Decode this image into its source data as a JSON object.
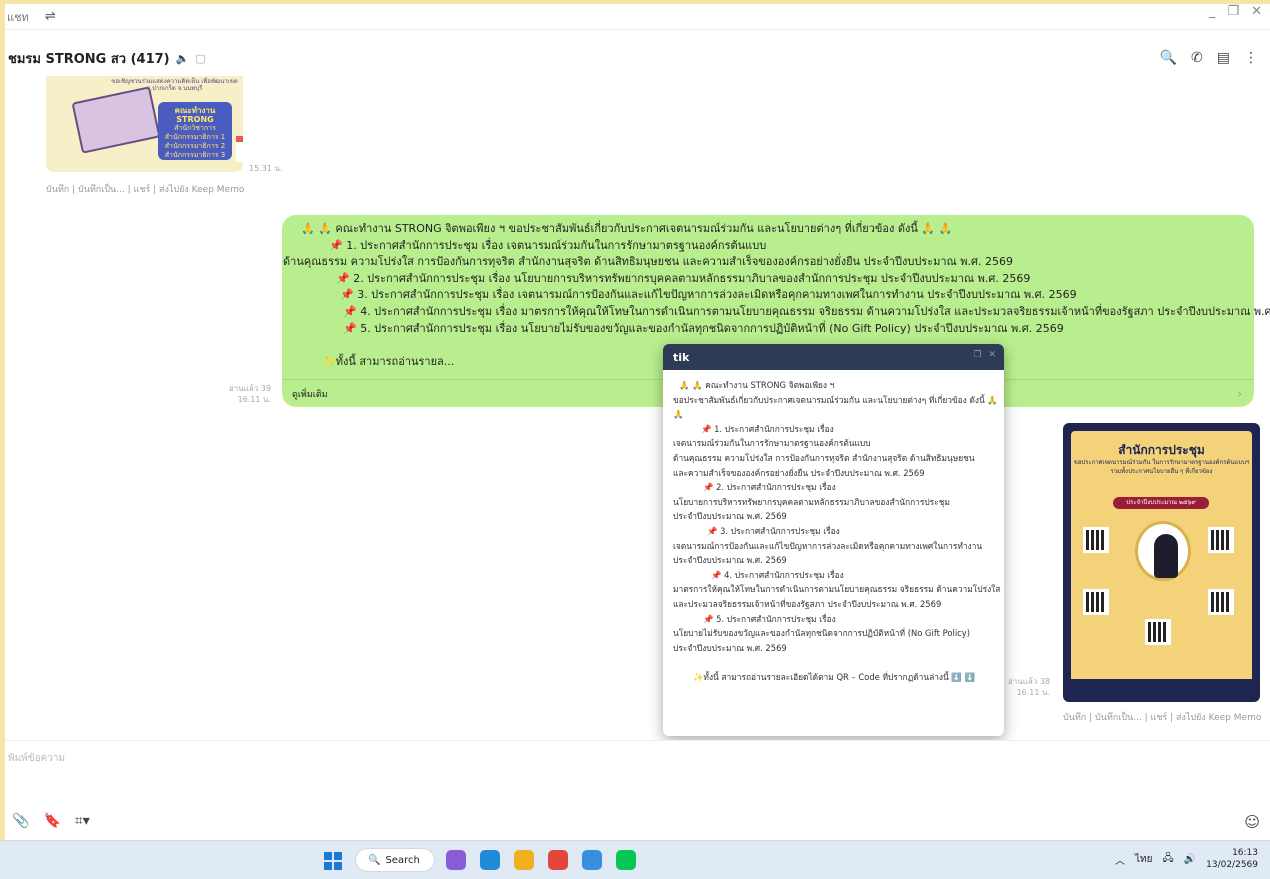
{
  "topbar": {
    "text": "แชท",
    "filter_icon": "filter-icon",
    "window_controls": [
      "_",
      "❐",
      "✕"
    ]
  },
  "chat": {
    "title": "ชมรม STRONG สว (417)",
    "header_icons_right": [
      "search-icon",
      "phone-icon",
      "notes-icon",
      "menu-icon"
    ]
  },
  "message1": {
    "image_top_text": "ขอเชิญชวนร่วมแสดงความคิดเห็น เพื่อพัฒนาเขต อ.ปากเกร็ด จ.นนทบุรี",
    "board_title": "คณะทำงาน STRONG",
    "board_lines": [
      "สำนักวิชาการ",
      "สำนักกรรมาธิการ 1",
      "สำนักกรรมาธิการ 2",
      "สำนักกรรมาธิการ 3"
    ],
    "time": "15.31 น.",
    "actions": "บันทึก | บันทึกเป็น... | แชร์ | ส่งไปยัง Keep Memo"
  },
  "message2": {
    "lines": [
      "🙏 🙏 คณะทำงาน STRONG จิตพอเพียง ฯ ขอประชาสัมพันธ์เกี่ยวกับประกาศเจตนารมณ์ร่วมกัน และนโยบายต่างๆ ที่เกี่ยวข้อง ดังนี้ 🙏 🙏",
      "📌 1. ประกาศสำนักการประชุม เรื่อง เจตนารมณ์ร่วมกันในการรักษามาตรฐานองค์กรต้นแบบ",
      "ด้านคุณธรรม ความโปร่งใส การป้องกันการทุจริต สำนักงานสุจริต ด้านสิทธิมนุษยชน และความสำเร็จขององค์กรอย่างยั่งยืน ประจำปีงบประมาณ พ.ศ. 2569",
      "📌 2. ประกาศสำนักการประชุม เรื่อง  นโยบายการบริหารทรัพยากรบุคคลตามหลักธรรมาภิบาลของสำนักการประชุม ประจำปีงบประมาณ พ.ศ. 2569",
      "📌 3. ประกาศสำนักการประชุม เรื่อง  เจตนารมณ์การป้องกันและแก้ไขปัญหาการล่วงละเมิดหรือคุกคามทางเพศในการทำงาน ประจำปีงบประมาณ พ.ศ. 2569",
      "📌 4. ประกาศสำนักการประชุม เรื่อง  มาตรการให้คุณให้โทษในการดำเนินการตามนโยบายคุณธรรม จริยธรรม ด้านความโปร่งใส และประมวลจริยธรรมเจ้าหน้าที่ของรัฐสภา ประจำปีงบประมาณ พ.ศ. 2569",
      "📌 5. ประกาศสำนักการประชุม เรื่อง  นโยบายไม่รับของขวัญและของกำนัลทุกชนิดจากการปฏิบัติหน้าที่ (No Gift Policy) ประจำปีงบประมาณ พ.ศ. 2569",
      "",
      "✨ทั้งนี้ สามารถอ่านรายล..."
    ],
    "see_more": "ดูเพิ่มเติม",
    "read": "อ่านแล้ว 39",
    "time": "16.11 น."
  },
  "popup": {
    "title": "tik",
    "lines": [
      "🙏 🙏 คณะทำงาน STRONG จิตพอเพียง ฯ",
      "ขอประชาสัมพันธ์เกี่ยวกับประกาศเจตนารมณ์ร่วมกัน และนโยบายต่างๆ ที่เกี่ยวข้อง ดังนี้ 🙏",
      "🙏",
      "📌 1. ประกาศสำนักการประชุม เรื่อง",
      "เจตนารมณ์ร่วมกันในการรักษามาตรฐานองค์กรต้นแบบ",
      "ด้านคุณธรรม ความโปร่งใส การป้องกันการทุจริต สำนักงานสุจริต ด้านสิทธิมนุษยชน",
      "และความสำเร็จขององค์กรอย่างยั่งยืน ประจำปีงบประมาณ พ.ศ. 2569",
      "📌 2. ประกาศสำนักการประชุม เรื่อง",
      "นโยบายการบริหารทรัพยากรบุคคลตามหลักธรรมาภิบาลของสำนักการประชุม",
      "ประจำปีงบประมาณ พ.ศ. 2569",
      "📌 3. ประกาศสำนักการประชุม เรื่อง",
      "เจตนารมณ์การป้องกันและแก้ไขปัญหาการล่วงละเมิดหรือคุกคามทางเพศในการทำงาน",
      "ประจำปีงบประมาณ พ.ศ. 2569",
      "📌 4. ประกาศสำนักการประชุม เรื่อง",
      "มาตรการให้คุณให้โทษในการดำเนินการตามนโยบายคุณธรรม จริยธรรม ด้านความโปร่งใส",
      "และประมวลจริยธรรมเจ้าหน้าที่ของรัฐสภา ประจำปีงบประมาณ พ.ศ. 2569",
      "📌 5. ประกาศสำนักการประชุม เรื่อง",
      "นโยบายไม่รับของขวัญและของกำนัลทุกชนิดจากการปฏิบัติหน้าที่ (No Gift Policy)",
      "ประจำปีงบประมาณ พ.ศ. 2569",
      "",
      "✨ทั้งนี้ สามารถอ่านรายละเอียดได้ตาม QR – Code ที่ปรากฏด้านล่างนี้ ⬇️ ⬇️"
    ]
  },
  "message3": {
    "poster_title": "สำนักการประชุม",
    "poster_sub": "ขอประกาศเจตนารมณ์ร่วมกัน ในการรักษามาตรฐานองค์กรต้นแบบฯ รวมทั้งประกาศนโยบายอื่น ๆ ที่เกี่ยวข้อง",
    "poster_band": "ประจำปีงบประมาณ ๒๕๖๙",
    "read": "อ่านแล้ว 38",
    "time": "16.11 น.",
    "actions": "บันทึก | บันทึกเป็น... | แชร์ | ส่งไปยัง Keep Memo"
  },
  "input": {
    "placeholder": "พิมพ์ข้อความ"
  },
  "taskbar": {
    "search_label": "Search",
    "lang": "ไทย",
    "time": "16:13",
    "date": "13/02/2569",
    "app_colors": [
      "#8a5cd8",
      "#1f8ad8",
      "#f2b01e",
      "#e2463c",
      "#3a8ee0",
      "#06c755"
    ]
  }
}
